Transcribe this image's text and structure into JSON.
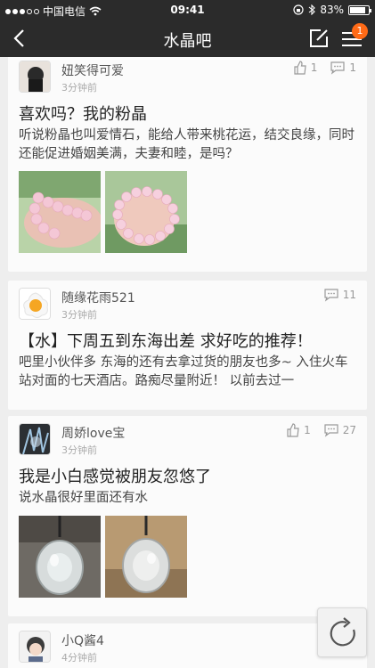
{
  "status_bar": {
    "carrier": "中国电信",
    "time": "09:41",
    "battery_percent": "83%",
    "battery_level": 0.83
  },
  "nav": {
    "title": "水晶吧",
    "menu_badge": "1"
  },
  "posts": [
    {
      "user": "妞笑得可爱",
      "time": "3分钟前",
      "likes": "1",
      "comments": "1",
      "title": "喜欢吗？我的粉晶",
      "body": "听说粉晶也叫爱情石，能给人带来桃花运，结交良缘，同时还能促进婚姻美满，夫妻和睦，是吗？"
    },
    {
      "user": "随缘花雨521",
      "time": "3分钟前",
      "comments": "11",
      "title": "【水】下周五到东海出差 求好吃的推荐！",
      "body": "吧里小伙伴多 东海的还有去拿过货的朋友也多~ 入住火车站对面的七天酒店。路痴尽量附近！ 以前去过一"
    },
    {
      "user": "周娇love宝",
      "time": "3分钟前",
      "likes": "1",
      "comments": "27",
      "title": "我是小白感觉被朋友忽悠了",
      "body": "说水晶很好里面还有水"
    },
    {
      "user": "小Q酱4",
      "time": "4分钟前"
    }
  ],
  "icons": {
    "back": "chevron-left-icon",
    "compose": "compose-icon",
    "menu": "menu-icon",
    "like": "thumbs-up-icon",
    "comment": "comment-bubble-icon",
    "refresh": "refresh-icon"
  }
}
